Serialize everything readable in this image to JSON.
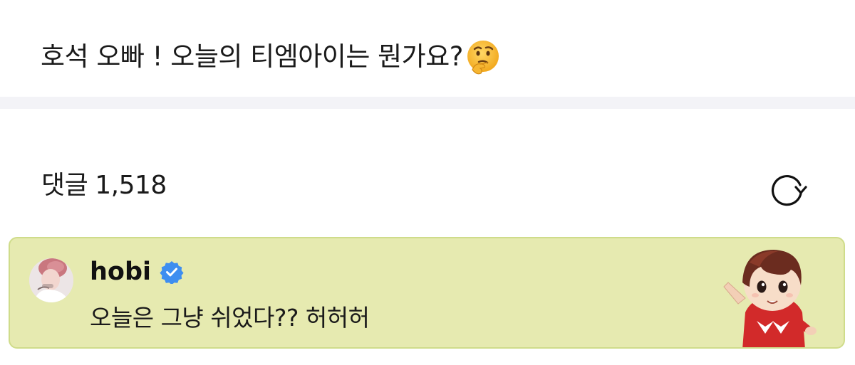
{
  "post": {
    "text": "호석 오빠 ! 오늘의 티엠아이는 뭔가요?",
    "emoji": "thinking-face-icon"
  },
  "comments": {
    "label": "댓글",
    "count": "1,518",
    "refresh_icon": "refresh-icon"
  },
  "highlighted_comment": {
    "author": "hobi",
    "verified": true,
    "text": "오늘은 그냥 쉬었다?? 허허허",
    "colors": {
      "background": "#e6eab0",
      "border": "#cfdc8a",
      "verified_badge": "#3e8ef0"
    }
  }
}
